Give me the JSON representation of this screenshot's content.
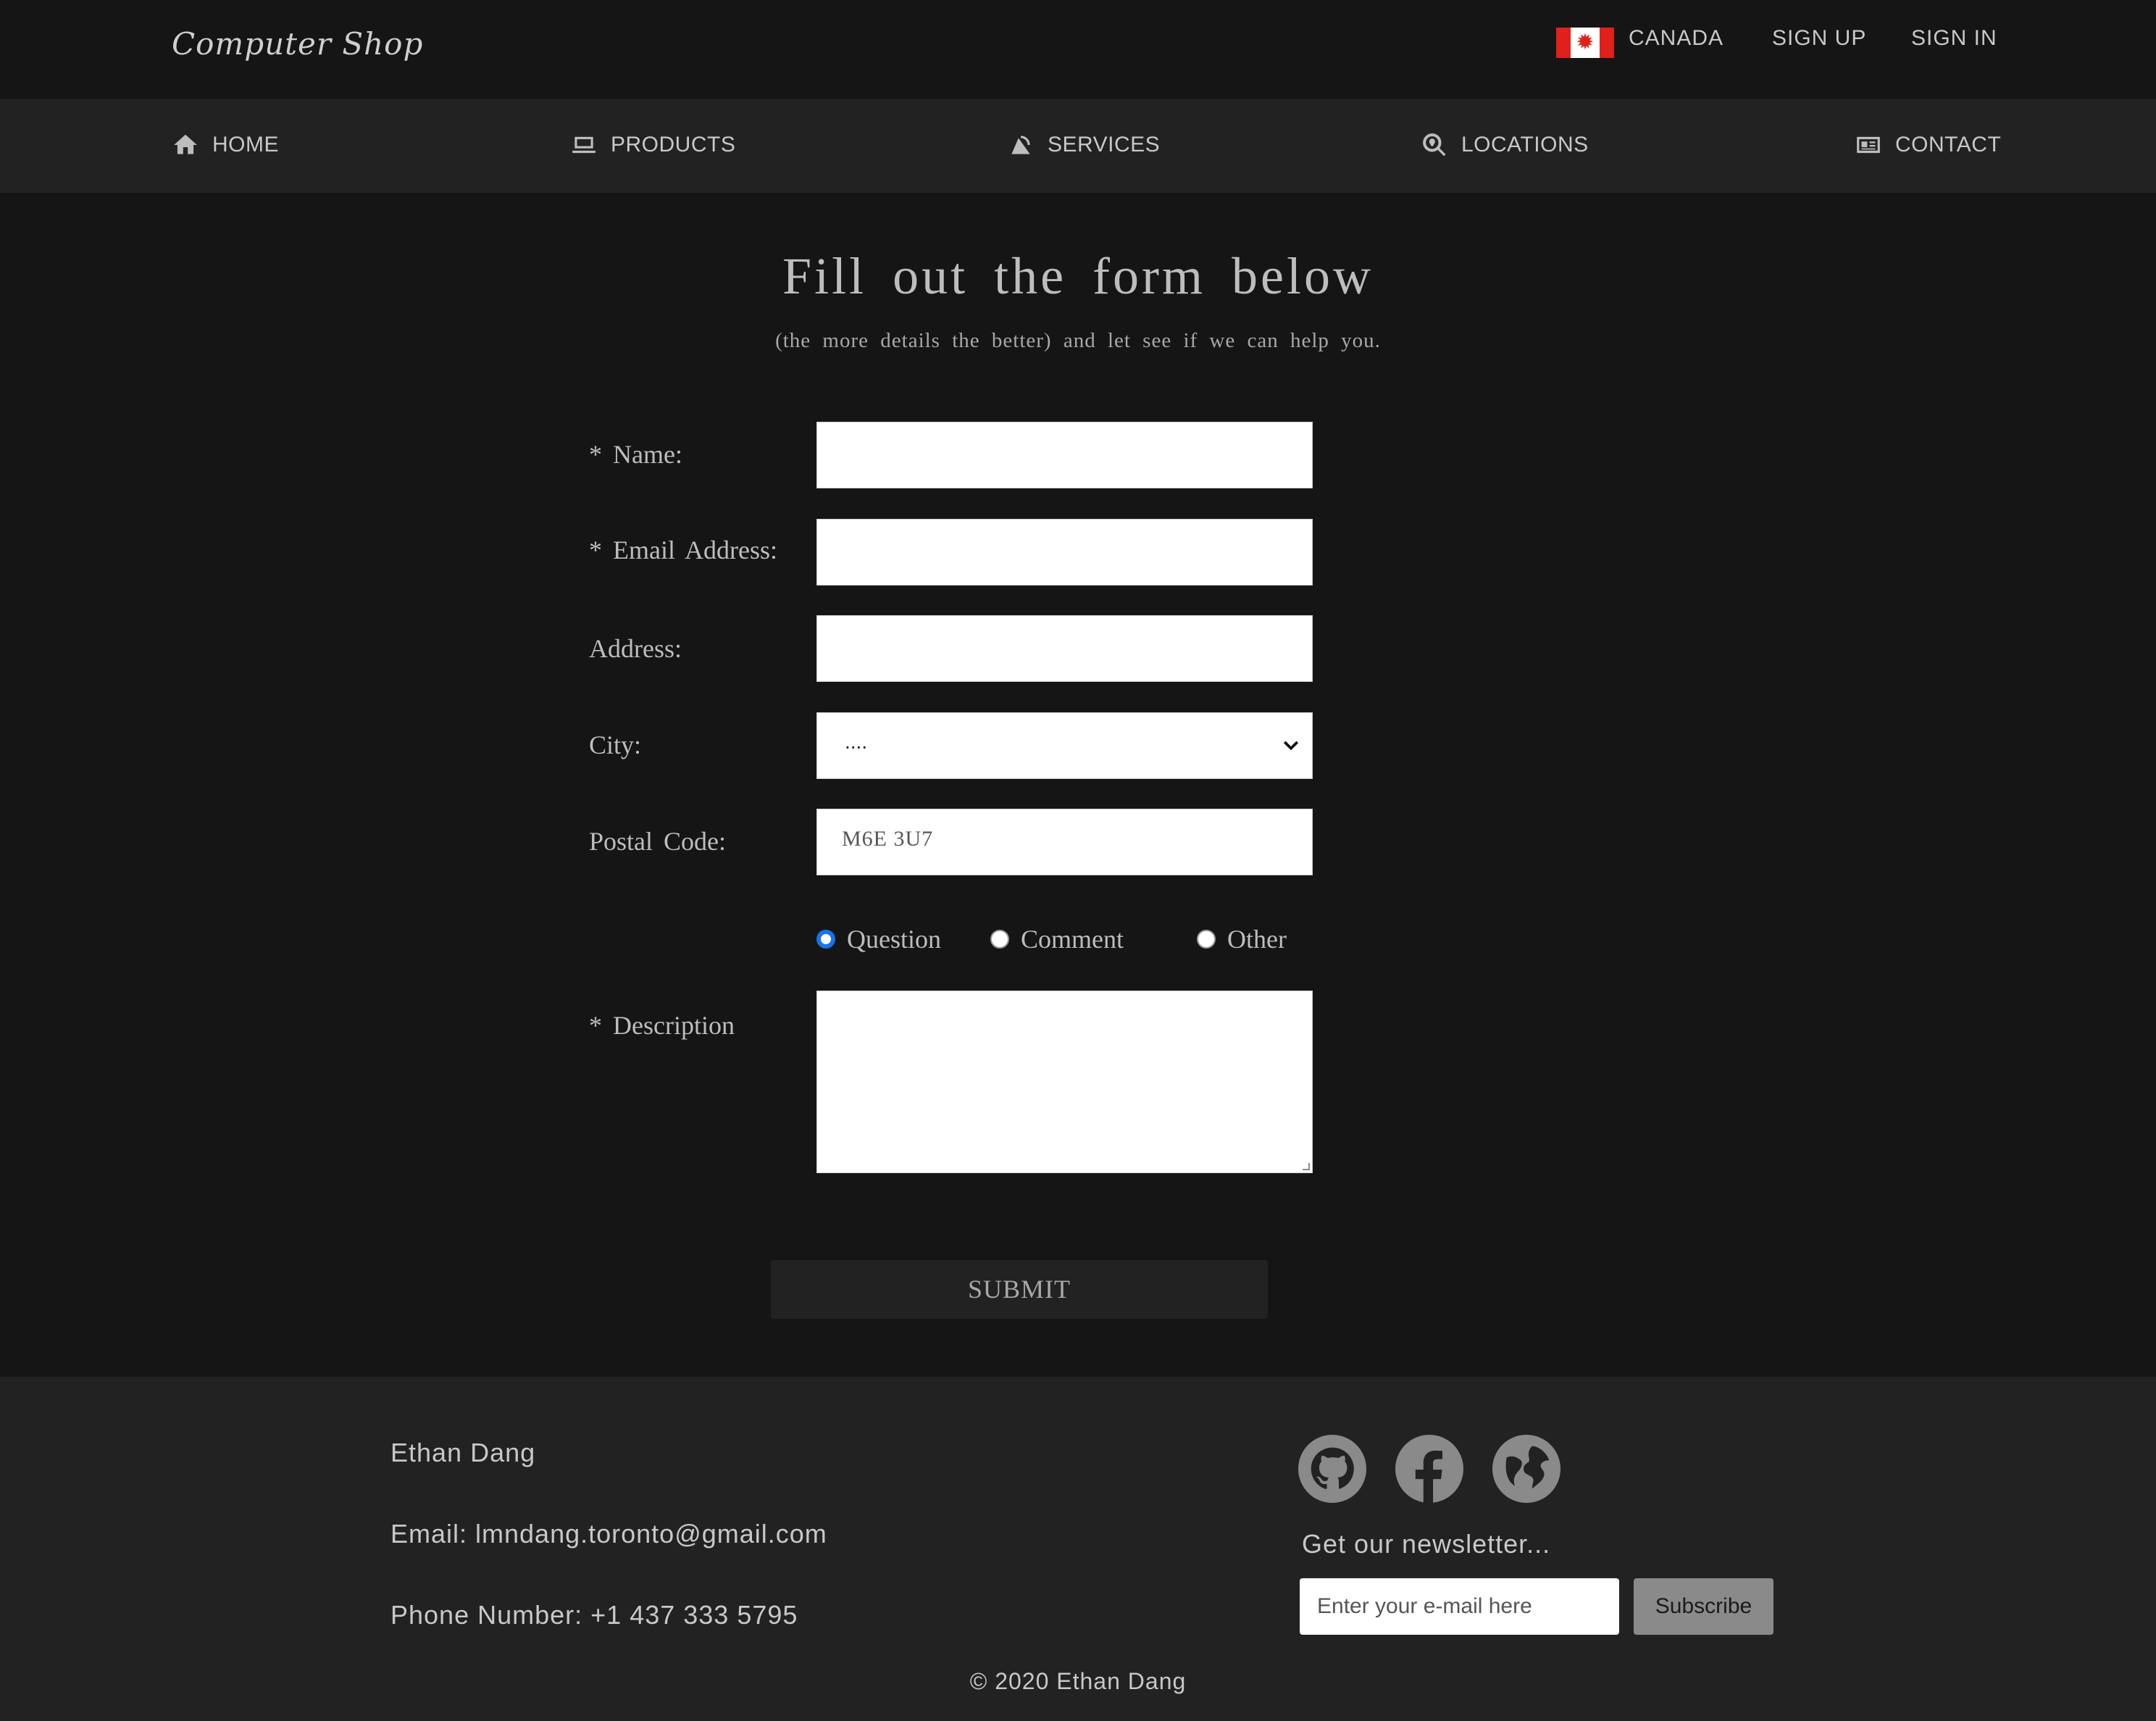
{
  "header": {
    "logo": "Computer Shop",
    "country": "CANADA",
    "sign_up": "SIGN UP",
    "sign_in": "SIGN IN"
  },
  "nav": {
    "items": [
      {
        "label": "HOME",
        "icon": "home-icon"
      },
      {
        "label": "PRODUCTS",
        "icon": "laptop-icon"
      },
      {
        "label": "SERVICES",
        "icon": "satellite-dish-icon"
      },
      {
        "label": "LOCATIONS",
        "icon": "search-location-icon"
      },
      {
        "label": "CONTACT",
        "icon": "id-card-icon"
      }
    ]
  },
  "form": {
    "title": "Fill out the form below",
    "subtitle": "(the more details the better) and let see if we can help you.",
    "name_label": "* Name:",
    "email_label": "* Email Address:",
    "address_label": "Address:",
    "city_label": "City:",
    "city_value": "....",
    "postal_label": "Postal Code:",
    "postal_placeholder": "M6E 3U7",
    "radio_options": [
      "Question",
      "Comment",
      "Other"
    ],
    "radio_selected": "Question",
    "description_label": "* Description",
    "submit_label": "SUBMIT"
  },
  "footer": {
    "name": "Ethan Dang",
    "email": "Email: lmndang.toronto@gmail.com",
    "phone": "Phone Number: +1 437 333 5795",
    "social_icons": [
      "github-icon",
      "facebook-icon",
      "globe-icon"
    ],
    "newsletter_title": "Get our newsletter...",
    "newsletter_placeholder": "Enter your e-mail here",
    "subscribe_label": "Subscribe",
    "copyright": "© 2020 Ethan Dang"
  },
  "colors": {
    "background": "#151515",
    "bar": "#222222",
    "flag_red": "#e0201a",
    "radio_accent": "#1a73e8"
  }
}
